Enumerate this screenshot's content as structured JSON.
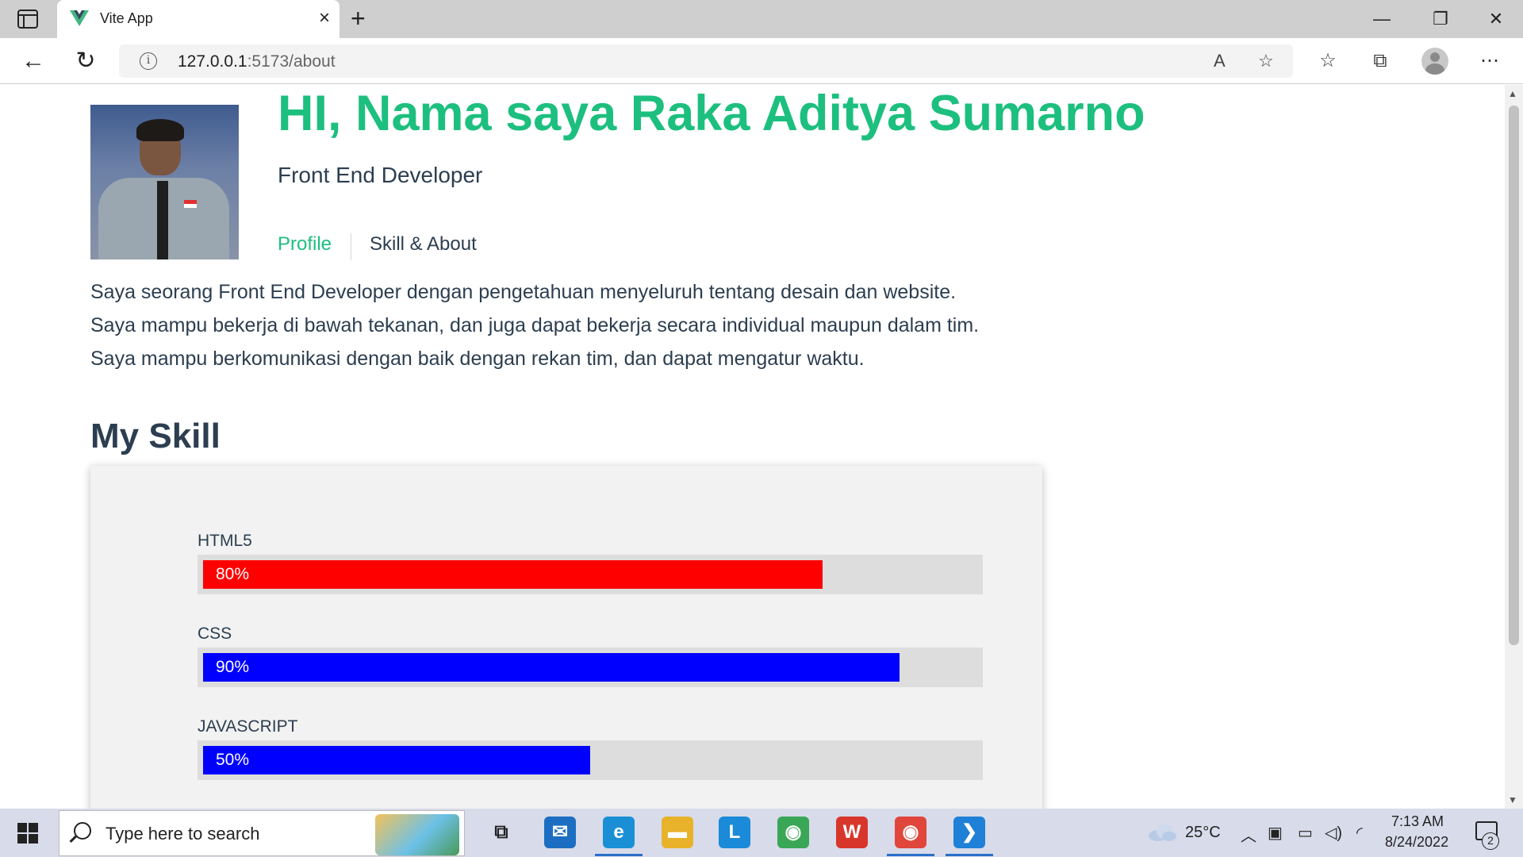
{
  "browser": {
    "tab_title": "Vite App",
    "tab_close": "×",
    "new_tab": "+",
    "window_controls": {
      "minimize": "—",
      "restore": "❐",
      "close": "✕"
    },
    "back_icon": "←",
    "reload_icon": "↻",
    "url_host": "127.0.0.1",
    "url_rest": ":5173/about",
    "read_aloud_icon": "A",
    "add_favorite_icon": "☆",
    "favorites_icon": "☆",
    "collections_icon": "⧉",
    "menu_icon": "⋯",
    "info_icon": "i"
  },
  "page": {
    "title": "HI, Nama saya Raka Aditya Sumarno",
    "subtitle": "Front End Developer",
    "nav": [
      {
        "label": "Profile"
      },
      {
        "label": "Skill & About"
      }
    ],
    "bio": [
      "Saya seorang Front End Developer dengan pengetahuan menyeluruh tentang desain dan website.",
      "Saya mampu bekerja di bawah tekanan, dan juga dapat bekerja secara individual maupun dalam tim.",
      "Saya mampu berkomunikasi dengan baik dengan rekan tim, dan dapat mengatur waktu."
    ],
    "skill_heading": "My Skill",
    "skills": [
      {
        "name": "HTML5",
        "percent_label": "80%",
        "level": 0.8,
        "color": "#ff0000"
      },
      {
        "name": "CSS",
        "percent_label": "90%",
        "level": 0.9,
        "color": "#0000ff"
      },
      {
        "name": "JAVASCRIPT",
        "percent_label": "50%",
        "level": 0.5,
        "color": "#0000ff"
      }
    ]
  },
  "taskbar": {
    "search_placeholder": "Type here to search",
    "weather": "25°C",
    "time": "7:13 AM",
    "date": "8/24/2022",
    "notification_count": "2",
    "apps": [
      {
        "name": "task-view",
        "glyph": "⧉",
        "color": "#d8dbea"
      },
      {
        "name": "mail",
        "glyph": "✉",
        "color": "#1b6ec2"
      },
      {
        "name": "edge",
        "glyph": "e",
        "color": "#1a8fd6"
      },
      {
        "name": "file-explorer",
        "glyph": "▬",
        "color": "#e8b22a"
      },
      {
        "name": "app-l",
        "glyph": "L",
        "color": "#1b8ad9"
      },
      {
        "name": "chrome",
        "glyph": "◉",
        "color": "#3aa757"
      },
      {
        "name": "wps-office",
        "glyph": "W",
        "color": "#d9362b"
      },
      {
        "name": "chrome-profile",
        "glyph": "◉",
        "color": "#e0463b"
      },
      {
        "name": "vscode",
        "glyph": "❯",
        "color": "#1f80d8"
      }
    ]
  },
  "colors": {
    "accent": "#1dbf7f",
    "text": "#2c3e50"
  }
}
